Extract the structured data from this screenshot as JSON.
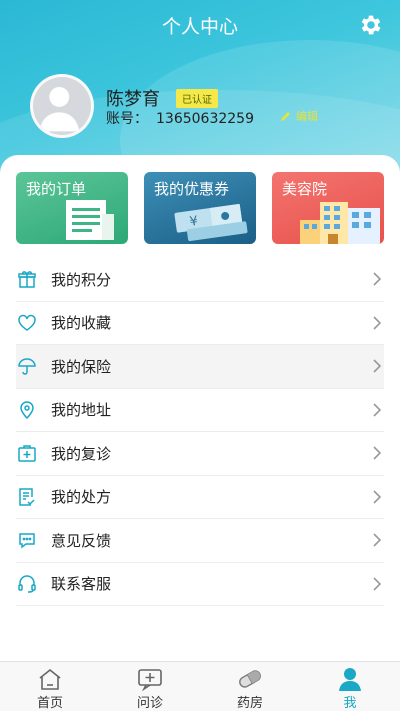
{
  "header": {
    "title": "个人中心",
    "settings_icon": "gear-icon"
  },
  "user": {
    "name": "陈梦育",
    "verified_badge": "已认证",
    "account_label": "账号：",
    "account_number": "13650632259",
    "edit_label": "编辑"
  },
  "tiles": [
    {
      "label": "我的订单",
      "icon": "document-icon",
      "color": "#3fb585"
    },
    {
      "label": "我的优惠券",
      "icon": "coupon-ticket-icon",
      "color": "#2a77a0"
    },
    {
      "label": "美容院",
      "icon": "building-icon",
      "color": "#ee5f59"
    }
  ],
  "menu": [
    {
      "label": "我的积分",
      "icon": "gift-icon"
    },
    {
      "label": "我的收藏",
      "icon": "heart-icon"
    },
    {
      "label": "我的保险",
      "icon": "umbrella-icon"
    },
    {
      "label": "我的地址",
      "icon": "location-pin-icon"
    },
    {
      "label": "我的复诊",
      "icon": "medical-kit-icon"
    },
    {
      "label": "我的处方",
      "icon": "prescription-icon"
    },
    {
      "label": "意见反馈",
      "icon": "chat-bubble-icon"
    },
    {
      "label": "联系客服",
      "icon": "headset-icon"
    }
  ],
  "nav": [
    {
      "label": "首页",
      "icon": "home-icon"
    },
    {
      "label": "问诊",
      "icon": "consult-icon"
    },
    {
      "label": "药房",
      "icon": "pill-icon"
    },
    {
      "label": "我",
      "icon": "user-icon"
    }
  ],
  "colors": {
    "accent": "#19a8c6",
    "header": "#3dc6dd",
    "badge": "#f7e84a"
  }
}
